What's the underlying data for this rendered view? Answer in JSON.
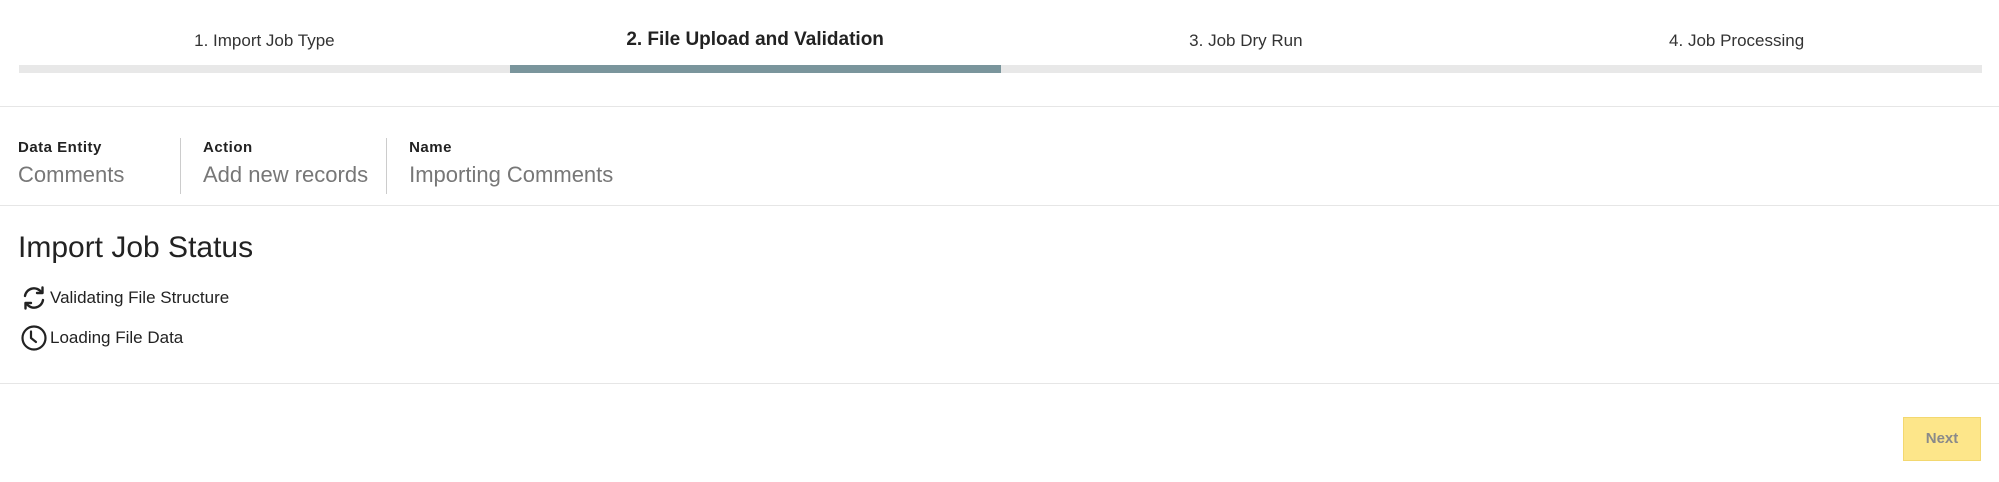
{
  "stepper": {
    "steps": [
      {
        "label": "1. Import Job Type",
        "active": false
      },
      {
        "label": "2. File Upload and Validation",
        "active": true
      },
      {
        "label": "3. Job Dry Run",
        "active": false
      },
      {
        "label": "4. Job Processing",
        "active": false
      }
    ],
    "active_color": "#7a959c",
    "inactive_color": "#e8e8e8"
  },
  "summary": {
    "data_entity": {
      "label": "Data Entity",
      "value": "Comments"
    },
    "action": {
      "label": "Action",
      "value": "Add new records"
    },
    "name": {
      "label": "Name",
      "value": "Importing Comments"
    }
  },
  "status": {
    "title": "Import Job Status",
    "items": [
      {
        "icon": "sync-icon",
        "text": "Validating File Structure"
      },
      {
        "icon": "clock-icon",
        "text": "Loading File Data"
      }
    ]
  },
  "footer": {
    "next_label": "Next",
    "next_color": "#fde68a"
  }
}
